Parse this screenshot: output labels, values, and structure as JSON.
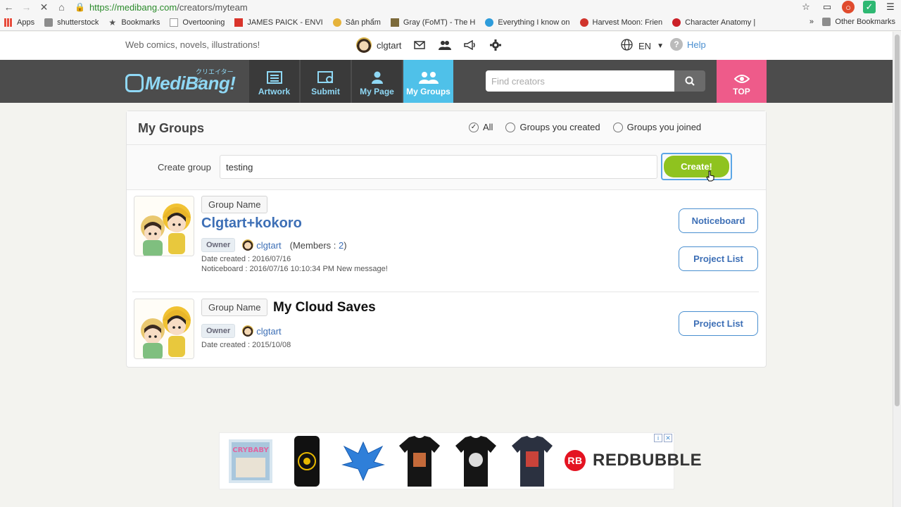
{
  "browser": {
    "url_host": "https://medibang.com",
    "url_path": "/creators/myteam",
    "bookmarks": [
      {
        "label": "Apps",
        "icon": "apps-grid-icon",
        "color": "#e74c3c"
      },
      {
        "label": "shutterstock",
        "icon": "folder-icon",
        "color": "#8c8c8c"
      },
      {
        "label": "Bookmarks",
        "icon": "star-icon",
        "color": "#666666"
      },
      {
        "label": "Overtooning",
        "icon": "page-icon",
        "color": "#999999"
      },
      {
        "label": "JAMES PAICK - ENVI",
        "icon": "site-icon",
        "color": "#d9342b"
      },
      {
        "label": "Sản phẩm",
        "icon": "site-icon",
        "color": "#e6b33a"
      },
      {
        "label": "Gray (FoMT) - The H",
        "icon": "site-icon",
        "color": "#7c6a3a"
      },
      {
        "label": "Everything I know on",
        "icon": "site-icon",
        "color": "#2d9cdb"
      },
      {
        "label": "Harvest Moon: Frien",
        "icon": "site-icon",
        "color": "#d0342c"
      },
      {
        "label": "Character Anatomy |",
        "icon": "pinterest-icon",
        "color": "#cb2027"
      }
    ],
    "bookmarks_overflow": "»",
    "other_bookmarks": "Other Bookmarks"
  },
  "topstrip": {
    "tagline": "Web comics, novels, illustrations!",
    "username": "clgtart",
    "language": "EN",
    "help": "Help"
  },
  "nav": {
    "logo": "MediBang!",
    "logo_sub": "クリエイターズ",
    "items": [
      {
        "label": "Artwork",
        "icon": "artwork-icon"
      },
      {
        "label": "Submit",
        "icon": "submit-icon"
      },
      {
        "label": "My Page",
        "icon": "person-icon"
      },
      {
        "label": "My Groups",
        "icon": "group-icon"
      }
    ],
    "search_placeholder": "Find creators",
    "top_label": "TOP"
  },
  "main": {
    "title": "My Groups",
    "filters": [
      {
        "label": "All",
        "checked": true
      },
      {
        "label": "Groups you created",
        "checked": false
      },
      {
        "label": "Groups you joined",
        "checked": false
      }
    ],
    "create_label": "Create group",
    "create_value": "testing",
    "create_button": "Create!",
    "groups": [
      {
        "tag": "Group Name",
        "name": "Clgtart+kokoro",
        "owner_badge": "Owner",
        "owner": "clgtart",
        "members_prefix": "(Members : ",
        "members_count": "2",
        "members_suffix": ")",
        "date_created": "Date created : 2016/07/16",
        "noticeboard_info": "Noticeboard : 2016/07/16 10:10:34 PM New message!",
        "buttons": [
          "Noticeboard",
          "Project List"
        ]
      },
      {
        "tag": "Group Name",
        "name": "My Cloud Saves",
        "owner_badge": "Owner",
        "owner": "clgtart",
        "date_created": "Date created : 2015/10/08",
        "buttons": [
          "Project List"
        ]
      }
    ]
  },
  "ads": {
    "brand": "REDBUBBLE",
    "brand_logo": "RB",
    "items": [
      "CRYBABY poster",
      "phone case",
      "mystic bird print",
      "black t-shirt",
      "black t-shirt",
      "navy t-shirt"
    ]
  },
  "colors": {
    "nav_bg": "#4c4c4c",
    "nav_active": "#4fc1e9",
    "top_pink": "#ee5b8a",
    "create_green": "#8fc31f",
    "link_blue": "#3d6fb6"
  }
}
